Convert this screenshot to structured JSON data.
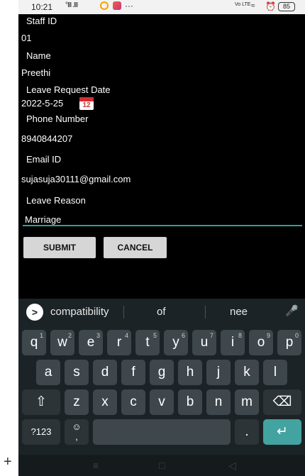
{
  "status_bar": {
    "time": "10:21",
    "signal": "°ΙΙΙ .ΙΙΙ",
    "more": "···",
    "network": "Vo LTE",
    "battery": "85"
  },
  "form": {
    "staff_id_label": "Staff ID",
    "staff_id_value": "01",
    "name_label": "Name",
    "name_value": "Preethi",
    "leave_date_label": "Leave Request Date",
    "leave_date_value": "2022-5-25",
    "calendar_icon_text": "12",
    "phone_label": "Phone Number",
    "phone_value": "8940844207",
    "email_label": "Email ID",
    "email_value": "sujasuja30111@gmail.com",
    "reason_label": "Leave Reason",
    "reason_value": "Marriage",
    "submit_label": "SUBMIT",
    "cancel_label": "CANCEL"
  },
  "keyboard": {
    "suggestions": [
      "compatibility",
      "of",
      "nee"
    ],
    "row1": [
      {
        "key": "q",
        "hint": "1"
      },
      {
        "key": "w",
        "hint": "2"
      },
      {
        "key": "e",
        "hint": "3"
      },
      {
        "key": "r",
        "hint": "4"
      },
      {
        "key": "t",
        "hint": "5"
      },
      {
        "key": "y",
        "hint": "6"
      },
      {
        "key": "u",
        "hint": "7"
      },
      {
        "key": "i",
        "hint": "8"
      },
      {
        "key": "o",
        "hint": "9"
      },
      {
        "key": "p",
        "hint": "0"
      }
    ],
    "row2": [
      "a",
      "s",
      "d",
      "f",
      "g",
      "h",
      "j",
      "k",
      "l"
    ],
    "row3": [
      "z",
      "x",
      "c",
      "v",
      "b",
      "n",
      "m"
    ],
    "symbols_label": "?123",
    "emoji_comma_label": ",",
    "period_label": "."
  },
  "colors": {
    "accent": "#26a69a",
    "enter_key": "#43a3a0"
  }
}
